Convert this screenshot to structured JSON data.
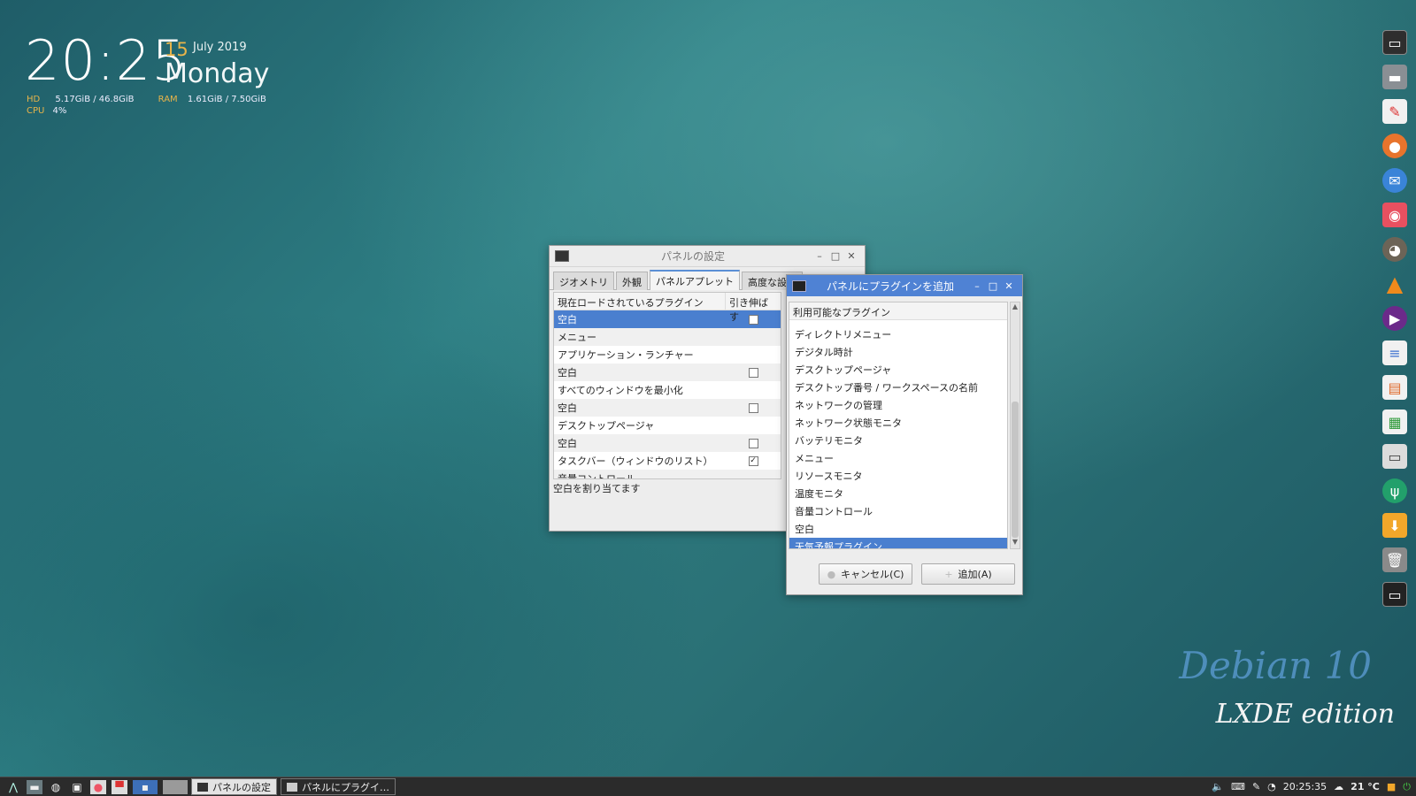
{
  "conky": {
    "time": "20:25",
    "day": "15",
    "month_year": "July 2019",
    "weekday": "Monday",
    "hd_label": "HD",
    "hd_value": "5.17GiB / 46.8GiB",
    "ram_label": "RAM",
    "ram_value": "1.61GiB / 7.50GiB",
    "cpu_label": "CPU",
    "cpu_value": "4%"
  },
  "watermark": {
    "line1": "Debian 10",
    "line2": "LXDE edition"
  },
  "panel_window": {
    "title": "パネルの設定",
    "tabs": [
      "ジオメトリ",
      "外観",
      "パネルアプレット",
      "高度な設定"
    ],
    "active_tab": "パネルアプレット",
    "col_plugin": "現在ロードされているプラグイン",
    "col_stretch": "引き伸ばす",
    "rows": [
      {
        "name": "空白",
        "stretch": "unchecked",
        "selected": true
      },
      {
        "name": "メニュー",
        "stretch": "none"
      },
      {
        "name": "アプリケーション・ランチャー",
        "stretch": "none"
      },
      {
        "name": "空白",
        "stretch": "unchecked"
      },
      {
        "name": "すべてのウィンドウを最小化",
        "stretch": "none"
      },
      {
        "name": "空白",
        "stretch": "unchecked"
      },
      {
        "name": "デスクトップページャ",
        "stretch": "none"
      },
      {
        "name": "空白",
        "stretch": "unchecked"
      },
      {
        "name": "タスクバー（ウィンドウのリスト）",
        "stretch": "checked"
      },
      {
        "name": "音量コントロール",
        "stretch": "none"
      }
    ],
    "status": "空白を割り当てます"
  },
  "add_dialog": {
    "title": "パネルにプラグインを追加",
    "list_header": "利用可能なプラグイン",
    "items": [
      "ディレクトリメニュー",
      "デジタル時計",
      "デスクトップページャ",
      "デスクトップ番号 / ワークスペースの名前",
      "ネットワークの管理",
      "ネットワーク状態モニタ",
      "バッテリモニタ",
      "メニュー",
      "リソースモニタ",
      "温度モニタ",
      "音量コントロール",
      "空白",
      "天気予報プラグイン"
    ],
    "selected_item": "天気予報プラグイン",
    "cancel_label": "キャンセル(C)",
    "add_label": "追加(A)"
  },
  "taskbar": {
    "tasks": [
      {
        "label": "パネルの設定",
        "active": true
      },
      {
        "label": "パネルにプラグイ…",
        "active": false
      }
    ],
    "clock": "20:25:35",
    "temperature": "21 °C"
  },
  "dock_icons": [
    "terminal-icon",
    "file-manager-icon",
    "text-editor-icon",
    "firefox-icon",
    "thunderbird-icon",
    "screenshot-icon",
    "gimp-icon",
    "vlc-icon",
    "media-player-icon",
    "document-icon",
    "presentation-icon",
    "spreadsheet-icon",
    "printer-icon",
    "plug-icon",
    "download-icon",
    "trash-icon",
    "monitor-icon"
  ],
  "colors": {
    "accent": "#4a7fcf",
    "titlebar_active": "#4f82d4",
    "conky_label": "#e8b44a"
  }
}
